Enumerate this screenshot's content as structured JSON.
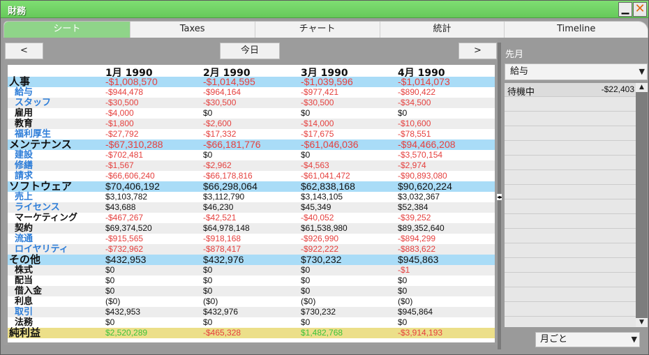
{
  "window": {
    "title": "財務"
  },
  "tabs": [
    {
      "label": "シート"
    },
    {
      "label": "Taxes"
    },
    {
      "label": "チャート"
    },
    {
      "label": "統計"
    },
    {
      "label": "Timeline"
    }
  ],
  "nav": {
    "prev": "<",
    "today": "今日",
    "next": ">"
  },
  "table": {
    "columns": [
      "1月 1990",
      "2月 1990",
      "3月 1990",
      "4月 1990"
    ],
    "rows": [
      {
        "label": "人事",
        "kind": "category",
        "values": [
          "-$1,008,570",
          "-$1,014,595",
          "-$1,039,596",
          "-$1,014,073"
        ]
      },
      {
        "label": "給与",
        "kind": "blue",
        "values": [
          "-$944,478",
          "-$964,164",
          "-$977,421",
          "-$890,422"
        ]
      },
      {
        "label": "スタッフ",
        "kind": "blue",
        "values": [
          "-$30,500",
          "-$30,500",
          "-$30,500",
          "-$34,500"
        ]
      },
      {
        "label": "雇用",
        "kind": "black",
        "values": [
          "-$4,000",
          "$0",
          "$0",
          "$0"
        ]
      },
      {
        "label": "教育",
        "kind": "black",
        "values": [
          "-$1,800",
          "-$2,600",
          "-$14,000",
          "-$10,600"
        ]
      },
      {
        "label": "福利厚生",
        "kind": "blue",
        "values": [
          "-$27,792",
          "-$17,332",
          "-$17,675",
          "-$78,551"
        ]
      },
      {
        "label": "メンテナンス",
        "kind": "category",
        "values": [
          "-$67,310,288",
          "-$66,181,776",
          "-$61,046,036",
          "-$94,466,208"
        ]
      },
      {
        "label": "建設",
        "kind": "blue",
        "values": [
          "-$702,481",
          "$0",
          "$0",
          "-$3,570,154"
        ]
      },
      {
        "label": "修繕",
        "kind": "blue",
        "values": [
          "-$1,567",
          "-$2,962",
          "-$4,563",
          "-$2,974"
        ]
      },
      {
        "label": "請求",
        "kind": "blue",
        "values": [
          "-$66,606,240",
          "-$66,178,816",
          "-$61,041,472",
          "-$90,893,080"
        ]
      },
      {
        "label": "ソフトウェア",
        "kind": "category",
        "values": [
          "$70,406,192",
          "$66,298,064",
          "$62,838,168",
          "$90,620,224"
        ]
      },
      {
        "label": "売上",
        "kind": "blue",
        "values": [
          "$3,103,782",
          "$3,112,790",
          "$3,143,105",
          "$3,032,367"
        ]
      },
      {
        "label": "ライセンス",
        "kind": "blue",
        "values": [
          "$43,688",
          "$46,230",
          "$45,349",
          "$52,384"
        ]
      },
      {
        "label": "マーケティング",
        "kind": "black",
        "values": [
          "-$467,267",
          "-$42,521",
          "-$40,052",
          "-$39,252"
        ]
      },
      {
        "label": "契約",
        "kind": "black",
        "values": [
          "$69,374,520",
          "$64,978,148",
          "$61,538,980",
          "$89,352,640"
        ]
      },
      {
        "label": "流通",
        "kind": "blue",
        "values": [
          "-$915,565",
          "-$918,168",
          "-$926,990",
          "-$894,299"
        ]
      },
      {
        "label": "ロイヤリティ",
        "kind": "blue",
        "values": [
          "-$732,962",
          "-$878,417",
          "-$922,222",
          "-$883,622"
        ]
      },
      {
        "label": "その他",
        "kind": "category",
        "values": [
          "$432,953",
          "$432,976",
          "$730,232",
          "$945,863"
        ]
      },
      {
        "label": "株式",
        "kind": "black",
        "values": [
          "$0",
          "$0",
          "$0",
          "-$1"
        ]
      },
      {
        "label": "配当",
        "kind": "black",
        "values": [
          "$0",
          "$0",
          "$0",
          "$0"
        ]
      },
      {
        "label": "借入金",
        "kind": "black",
        "values": [
          "$0",
          "$0",
          "$0",
          "$0"
        ]
      },
      {
        "label": "利息",
        "kind": "black",
        "values": [
          "($0)",
          "($0)",
          "($0)",
          "($0)"
        ]
      },
      {
        "label": "取引",
        "kind": "blue",
        "values": [
          "$432,953",
          "$432,976",
          "$730,232",
          "$945,864"
        ]
      },
      {
        "label": "法務",
        "kind": "black",
        "values": [
          "$0",
          "$0",
          "$0",
          "$0"
        ]
      },
      {
        "label": "純利益",
        "kind": "total",
        "values": [
          "$2,520,289",
          "-$465,328",
          "$1,482,768",
          "-$3,914,193"
        ]
      }
    ]
  },
  "side": {
    "title": "先月",
    "category_select": "給与",
    "items": [
      {
        "label": "待機中",
        "value": "-$22,403"
      }
    ],
    "period_select": "月ごと"
  },
  "colors": {
    "titlebar": "#6fd164",
    "category_row": "#a9dcf7",
    "total_row": "#ecdf89",
    "negative": "#e5413f",
    "positive_total": "#3cc23a",
    "blue_label": "#2d7dd8"
  },
  "icons": {
    "minimize": "minimize-icon",
    "close": "close-icon",
    "dropdown": "chevron-down-icon"
  }
}
